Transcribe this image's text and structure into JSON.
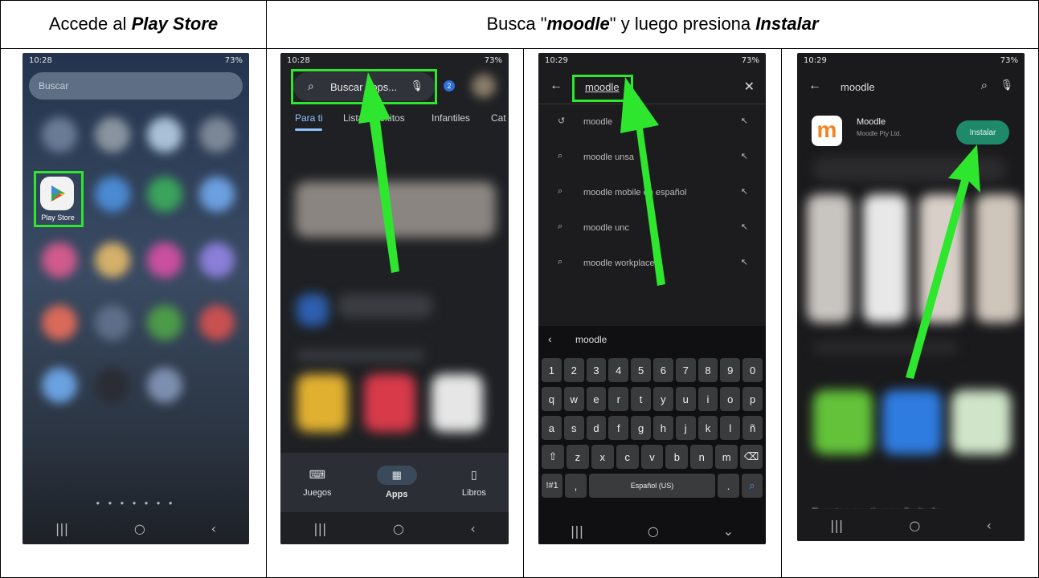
{
  "headers": {
    "col1": {
      "pre": "Accede al ",
      "em": "Play Store"
    },
    "col2": {
      "pre": "Busca \"",
      "em1": "moodle",
      "mid": "\" y luego presiona ",
      "em2": "Instalar"
    }
  },
  "phone1": {
    "status_time": "10:28",
    "status_right": "73%",
    "search_placeholder": "Buscar",
    "app_label": "Play Store"
  },
  "phone2": {
    "status_time": "10:28",
    "status_right": "73%",
    "search_text": "Buscar apps...",
    "notif_count": "2",
    "tabs": [
      "Para ti",
      "Lista de éxitos",
      "Infantiles",
      "Cat"
    ],
    "bottom_nav": [
      "Juegos",
      "Apps",
      "Libros"
    ]
  },
  "phone3": {
    "status_time": "10:29",
    "status_right": "73%",
    "query": "moodle",
    "suggestions": [
      "moodle",
      "moodle unsa",
      "moodle mobile en español",
      "moodle unc",
      "moodle workplace"
    ],
    "keyboard_suggestion": "moodle",
    "number_row": [
      "1",
      "2",
      "3",
      "4",
      "5",
      "6",
      "7",
      "8",
      "9",
      "0"
    ],
    "row1": [
      "q",
      "w",
      "e",
      "r",
      "t",
      "y",
      "u",
      "i",
      "o",
      "p"
    ],
    "row2": [
      "a",
      "s",
      "d",
      "f",
      "g",
      "h",
      "j",
      "k",
      "l",
      "ñ"
    ],
    "row3": [
      "z",
      "x",
      "c",
      "v",
      "b",
      "n",
      "m"
    ],
    "sym_key": "!#1",
    "comma_key": ",",
    "space_key": "Español (US)",
    "period_key": "."
  },
  "phone4": {
    "status_time": "10:29",
    "status_right": "73%",
    "query": "moodle",
    "app_name": "Moodle",
    "app_dev": "Moodle Pty Ltd.",
    "install_label": "Instalar",
    "bottom_text": "Eventos por tiempo limitado"
  },
  "colors": {
    "highlight": "#2ee62e",
    "install": "#1f8a6a"
  }
}
